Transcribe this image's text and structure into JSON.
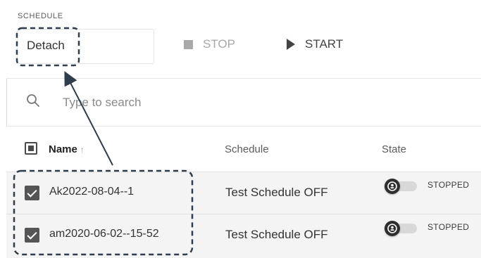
{
  "toolbar": {
    "section_title": "SCHEDULE",
    "schedule_value": "Detach",
    "stop_label": "STOP",
    "start_label": "START"
  },
  "search": {
    "placeholder": "Type to search",
    "icon": "search-icon"
  },
  "table": {
    "columns": {
      "name": "Name",
      "schedule": "Schedule",
      "state": "State"
    },
    "sort_indicator": "↑",
    "rows": [
      {
        "name": "Ak2022-08-04--1",
        "schedule": "Test Schedule OFF",
        "state": "STOPPED",
        "selected": true
      },
      {
        "name": "am2020-06-02--15-52",
        "schedule": "Test Schedule OFF",
        "state": "STOPPED",
        "selected": true
      }
    ]
  },
  "colors": {
    "annotation": "#2f3e4e",
    "toggle_knob": "#2e2e2e",
    "row_background": "#f4f4f4"
  }
}
